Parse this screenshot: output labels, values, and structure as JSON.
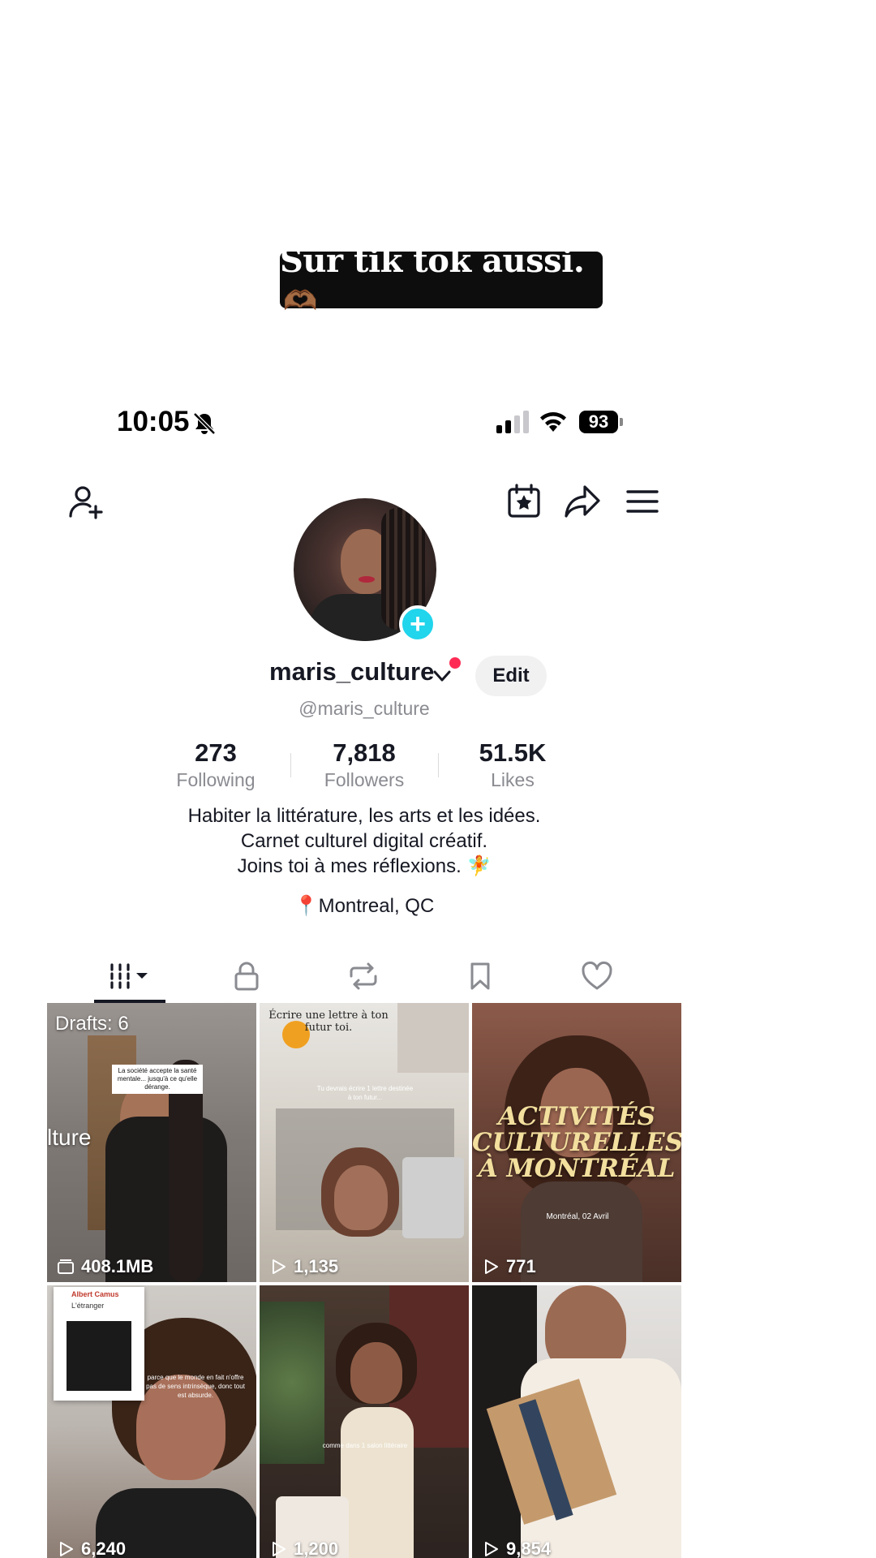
{
  "caption": {
    "text": "Sur tik tok aussi.",
    "emoji": "🫶🏾"
  },
  "status_bar": {
    "time": "10:05",
    "battery": "93"
  },
  "profile": {
    "username": "maris_culture",
    "handle": "@maris_culture",
    "edit_label": "Edit",
    "stats": [
      {
        "value": "273",
        "label": "Following"
      },
      {
        "value": "7,818",
        "label": "Followers"
      },
      {
        "value": "51.5K",
        "label": "Likes"
      }
    ],
    "bio": [
      "Habiter  la littérature, les arts et les idées.",
      "Carnet culturel digital créatif.",
      "Joins toi à mes réflexions."
    ],
    "bio_emoji": "🧚",
    "location": "Montreal, QC",
    "location_emoji": "📍"
  },
  "tabs": [
    "videos-grid-icon",
    "lock-icon",
    "repost-icon",
    "bookmark-icon",
    "heart-icon"
  ],
  "grid": [
    {
      "drafts_label": "Drafts: 6",
      "size": "408.1MB",
      "note": "La société accepte la santé mentale... jusqu'à ce qu'elle dérange.",
      "side_text": "lture"
    },
    {
      "views": "1,135",
      "header": "Écrire une lettre à ton futur toi.",
      "note": "Tu devrais écrire 1 lettre destinée à ton futur..."
    },
    {
      "views": "771",
      "title": "ACTIVITÉS CULTURELLES À MONTRÉAL",
      "subtitle": "Montréal, 02 Avril"
    },
    {
      "views": "6,240",
      "book_author": "Albert Camus",
      "book_title": "L'étranger",
      "note": "parce que le monde en fait n'offre pas de sens intrinsèque, donc tout est absurde."
    },
    {
      "views": "1,200",
      "note": "comme dans 1 salon littéraire"
    },
    {
      "views": "9,854"
    }
  ],
  "colors": {
    "accent_cyan": "#20d5ec",
    "notification_red": "#fe2c55",
    "text_primary": "#161823",
    "text_secondary": "#8a8b91"
  }
}
